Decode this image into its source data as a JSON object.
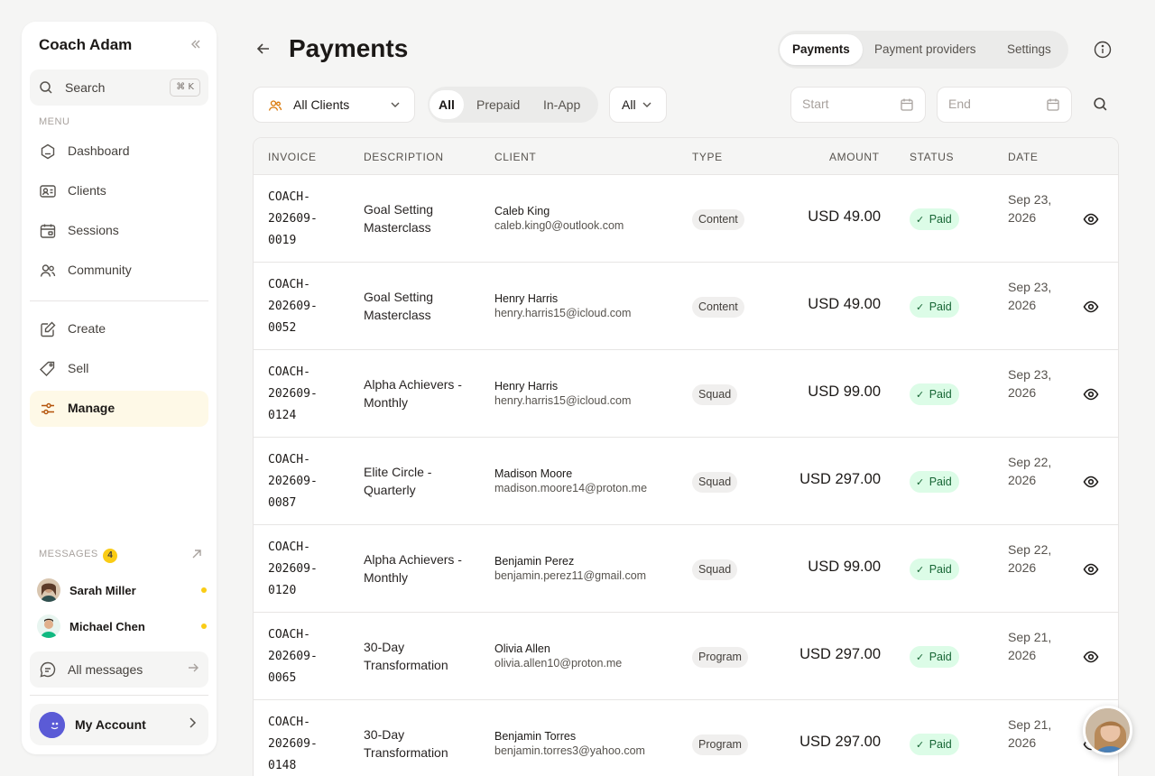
{
  "sidebar": {
    "title": "Coach Adam",
    "search_label": "Search",
    "search_shortcut": "⌘ K",
    "menu_label": "MENU",
    "menu_items": [
      {
        "label": "Dashboard",
        "icon": "dashboard-icon"
      },
      {
        "label": "Clients",
        "icon": "clients-icon"
      },
      {
        "label": "Sessions",
        "icon": "sessions-icon"
      },
      {
        "label": "Community",
        "icon": "community-icon"
      }
    ],
    "action_items": [
      {
        "label": "Create",
        "icon": "create-icon"
      },
      {
        "label": "Sell",
        "icon": "tag-icon"
      },
      {
        "label": "Manage",
        "icon": "sliders-icon",
        "active": true
      }
    ],
    "messages_label": "MESSAGES",
    "messages_count": "4",
    "messages": [
      {
        "name": "Sarah Miller",
        "unread": true
      },
      {
        "name": "Michael Chen",
        "unread": true
      }
    ],
    "all_messages_label": "All messages",
    "account_label": "My Account"
  },
  "header": {
    "title": "Payments",
    "tabs": [
      {
        "label": "Payments",
        "active": true
      },
      {
        "label": "Payment providers"
      },
      {
        "label": "Settings"
      }
    ]
  },
  "filters": {
    "clients_select": "All Clients",
    "segments": [
      {
        "label": "All",
        "active": true
      },
      {
        "label": "Prepaid"
      },
      {
        "label": "In-App"
      }
    ],
    "status_select": "All",
    "start_placeholder": "Start",
    "end_placeholder": "End"
  },
  "table": {
    "headers": {
      "invoice": "INVOICE",
      "description": "DESCRIPTION",
      "client": "CLIENT",
      "type": "TYPE",
      "amount": "AMOUNT",
      "status": "STATUS",
      "date": "DATE"
    },
    "rows": [
      {
        "invoice": "COACH-\n202609-\n0019",
        "description": "Goal Setting Masterclass",
        "client_name": "Caleb King",
        "client_email": "caleb.king0@outlook.com",
        "type": "Content",
        "amount": "USD 49.00",
        "status": "Paid",
        "date": "Sep 23, 2026"
      },
      {
        "invoice": "COACH-\n202609-\n0052",
        "description": "Goal Setting Masterclass",
        "client_name": "Henry Harris",
        "client_email": "henry.harris15@icloud.com",
        "type": "Content",
        "amount": "USD 49.00",
        "status": "Paid",
        "date": "Sep 23, 2026"
      },
      {
        "invoice": "COACH-\n202609-\n0124",
        "description": "Alpha Achievers - Monthly",
        "client_name": "Henry Harris",
        "client_email": "henry.harris15@icloud.com",
        "type": "Squad",
        "amount": "USD 99.00",
        "status": "Paid",
        "date": "Sep 23, 2026"
      },
      {
        "invoice": "COACH-\n202609-\n0087",
        "description": "Elite Circle - Quarterly",
        "client_name": "Madison Moore",
        "client_email": "madison.moore14@proton.me",
        "type": "Squad",
        "amount": "USD 297.00",
        "status": "Paid",
        "date": "Sep 22, 2026"
      },
      {
        "invoice": "COACH-\n202609-\n0120",
        "description": "Alpha Achievers - Monthly",
        "client_name": "Benjamin Perez",
        "client_email": "benjamin.perez11@gmail.com",
        "type": "Squad",
        "amount": "USD 99.00",
        "status": "Paid",
        "date": "Sep 22, 2026"
      },
      {
        "invoice": "COACH-\n202609-\n0065",
        "description": "30-Day Transformation",
        "client_name": "Olivia Allen",
        "client_email": "olivia.allen10@proton.me",
        "type": "Program",
        "amount": "USD 297.00",
        "status": "Paid",
        "date": "Sep 21, 2026"
      },
      {
        "invoice": "COACH-\n202609-\n0148",
        "description": "30-Day Transformation",
        "client_name": "Benjamin Torres",
        "client_email": "benjamin.torres3@yahoo.com",
        "type": "Program",
        "amount": "USD 297.00",
        "status": "Paid",
        "date": "Sep 21, 2026"
      }
    ]
  },
  "colors": {
    "accent_yellow": "#facc15",
    "active_bg": "#fef9e7",
    "paid_bg": "#dcfce7",
    "paid_text": "#166534"
  }
}
